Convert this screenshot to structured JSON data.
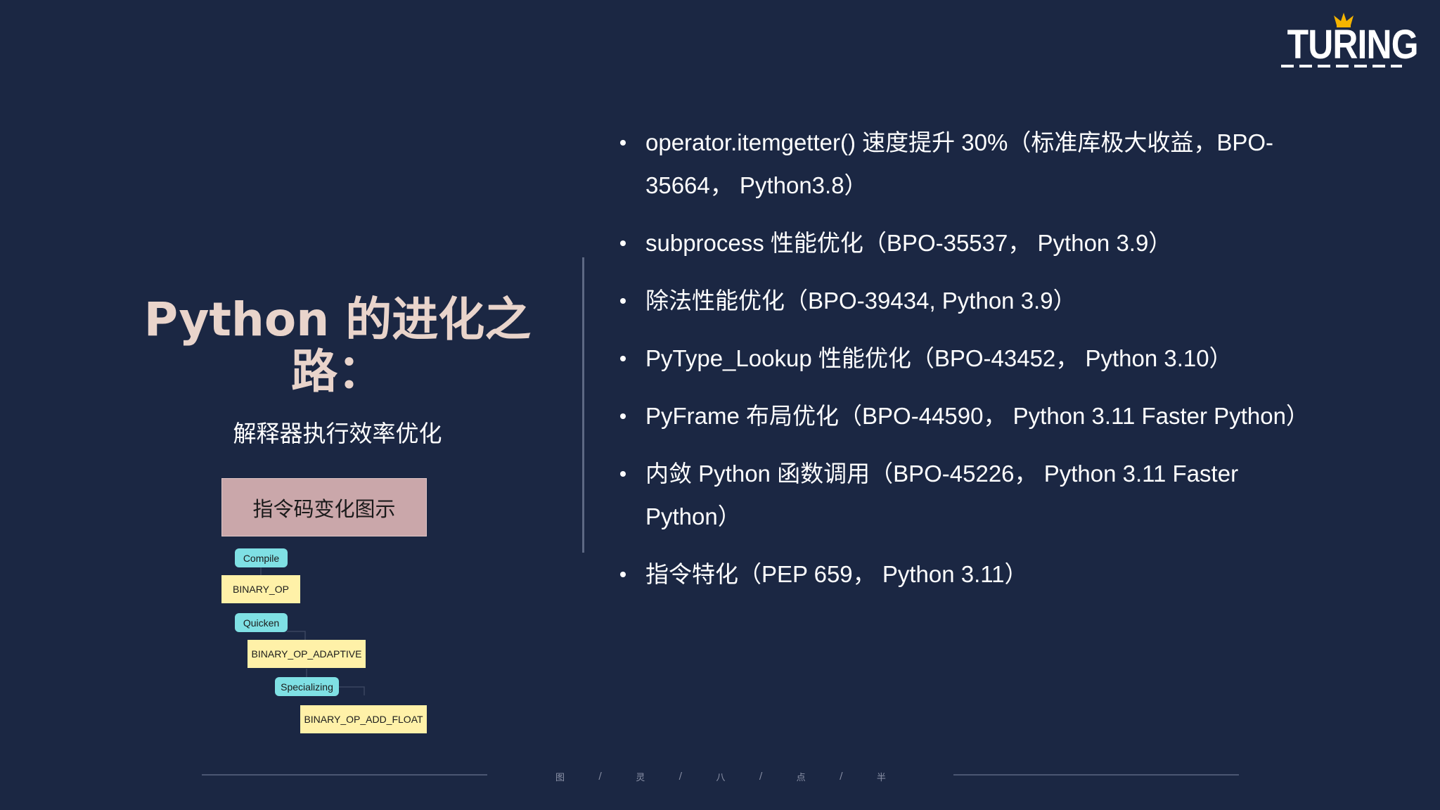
{
  "brand": {
    "logo_text": "TURING",
    "accent": "#f5b400"
  },
  "title": "Python 的进化之路：",
  "subtitle": "解释器执行效率优化",
  "diagram": {
    "heading": "指令码变化图示",
    "steps": [
      "Compile",
      "Quicken",
      "Specializing"
    ],
    "ops": [
      "BINARY_OP",
      "BINARY_OP_ADAPTIVE",
      "BINARY_OP_ADD_FLOAT"
    ]
  },
  "bullets": [
    "operator.itemgetter() 速度提升 30%（标准库极大收益，BPO-35664， Python3.8）",
    "subprocess 性能优化（BPO-35537， Python 3.9）",
    "除法性能优化（BPO-39434, Python 3.9）",
    "PyType_Lookup 性能优化（BPO-43452， Python 3.10）",
    "PyFrame 布局优化（BPO-44590， Python 3.11 Faster Python）",
    "内敛 Python 函数调用（BPO-45226， Python 3.11 Faster Python）",
    "指令特化（PEP 659， Python 3.11）"
  ],
  "footer": [
    "图",
    "/",
    "灵",
    "/",
    "八",
    "/",
    "点",
    "/",
    "半"
  ],
  "colors": {
    "background": "#1b2743",
    "title": "#e9d4cb",
    "box": "#caa7aa",
    "step_node": "#7fe0e4",
    "op_node": "#fff1a8"
  }
}
